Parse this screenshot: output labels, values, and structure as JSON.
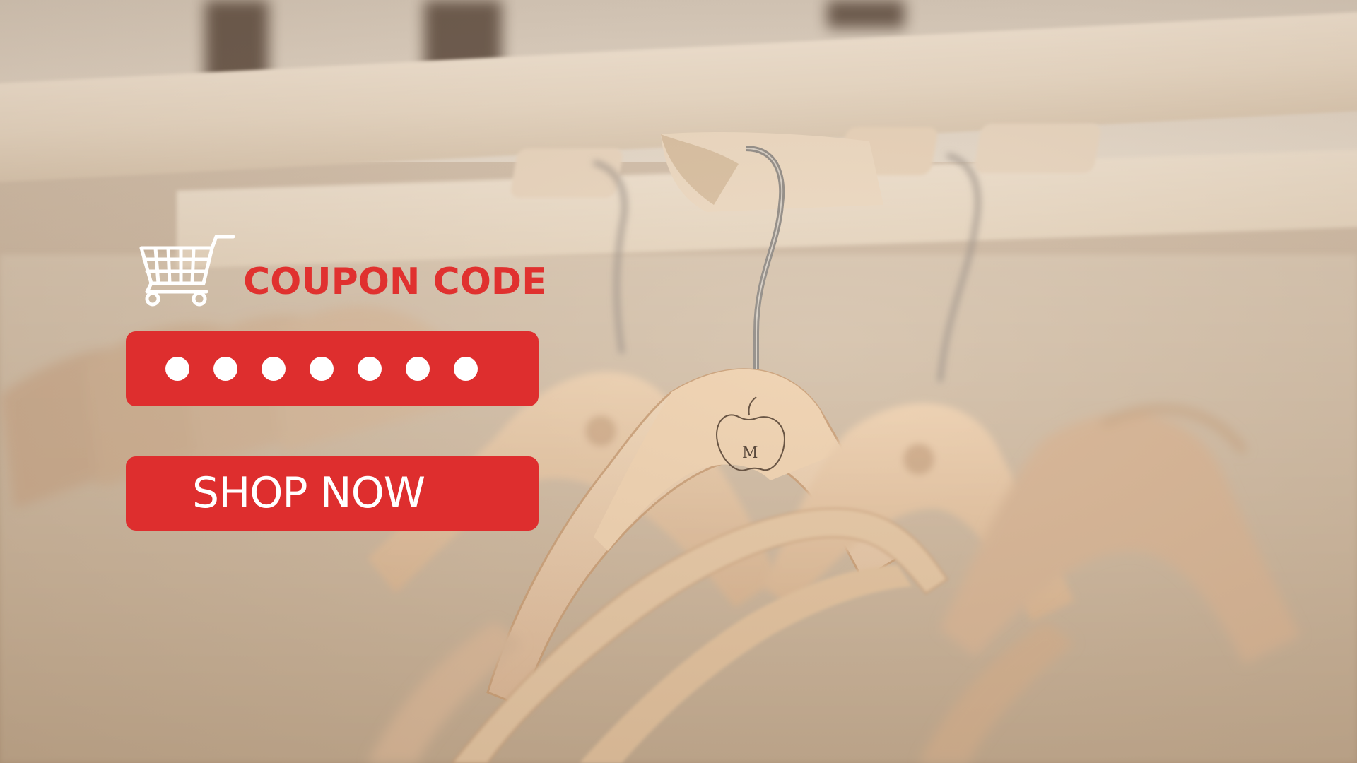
{
  "coupon": {
    "title": "COUPON CODE",
    "code_masked": "•••••••",
    "code_length": 7
  },
  "cta": {
    "label": "SHOP NOW"
  },
  "colors": {
    "accent": "#de2e2e",
    "title": "#e0312f",
    "dot": "#ffffff"
  },
  "icons": {
    "cart": "shopping-cart-icon"
  },
  "background": {
    "subject": "wooden clothes hangers on a rail",
    "hanger_mark": "M"
  }
}
